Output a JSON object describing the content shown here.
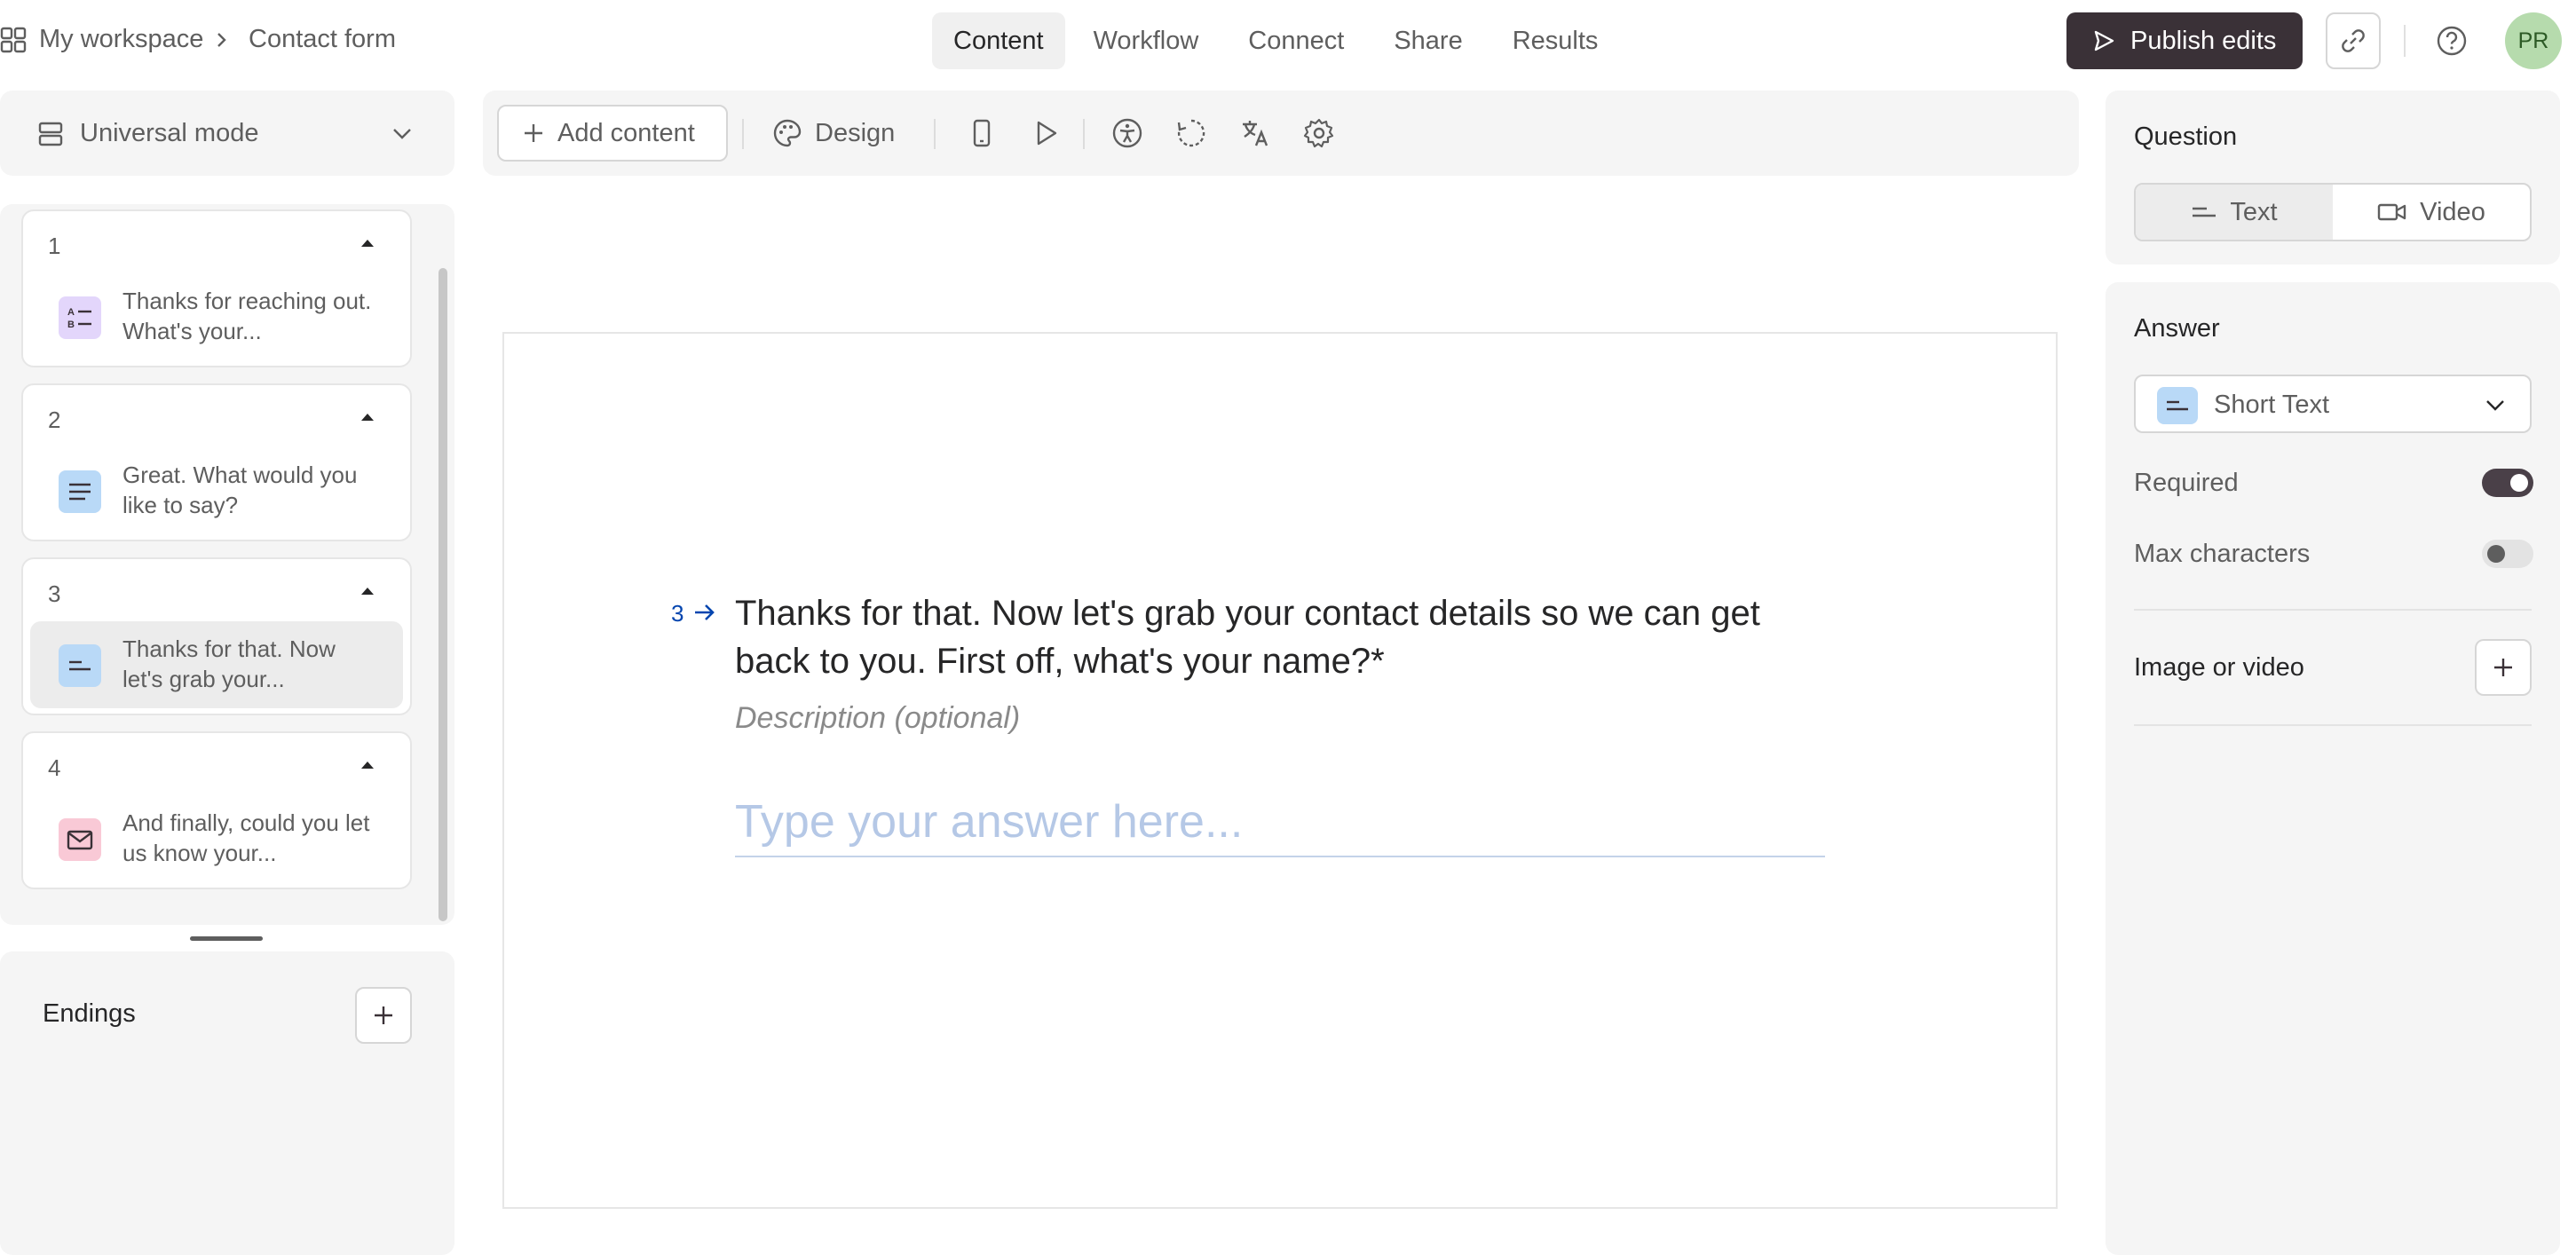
{
  "breadcrumb": {
    "workspace": "My workspace",
    "form": "Contact form"
  },
  "nav": {
    "tabs": [
      "Content",
      "Workflow",
      "Connect",
      "Share",
      "Results"
    ],
    "active": "Content"
  },
  "header": {
    "publish_label": "Publish edits",
    "avatar_initials": "PR"
  },
  "left_panel": {
    "mode_label": "Universal mode",
    "questions": [
      {
        "number": "1",
        "text": "Thanks for reaching out. What's your...",
        "icon": "multiple-choice-icon",
        "icon_bg": "#e3d6fb"
      },
      {
        "number": "2",
        "text": "Great. What would you like to say?",
        "icon": "long-text-icon",
        "icon_bg": "#b9d9f7"
      },
      {
        "number": "3",
        "text": "Thanks for that. Now let's grab your...",
        "icon": "short-text-icon",
        "icon_bg": "#b9d9f7",
        "selected": true
      },
      {
        "number": "4",
        "text": "And finally, could you let us know your...",
        "icon": "email-icon",
        "icon_bg": "#f9c9d6"
      }
    ],
    "endings_label": "Endings"
  },
  "toolbar": {
    "add_content_label": "Add content",
    "design_label": "Design"
  },
  "canvas": {
    "question_number": "3",
    "question_title": "Thanks for that. Now let's grab your contact details so we can get back to you. First off, what's your name?*",
    "description_placeholder": "Description (optional)",
    "answer_placeholder": "Type your answer here..."
  },
  "right_panel": {
    "question_heading": "Question",
    "question_types": [
      "Text",
      "Video"
    ],
    "question_type_active": "Text",
    "answer_heading": "Answer",
    "answer_type": "Short Text",
    "required_label": "Required",
    "required_on": true,
    "max_chars_label": "Max characters",
    "max_chars_on": false,
    "media_label": "Image or video"
  },
  "colors": {
    "accent_dark": "#3a3137",
    "avatar_bg": "#b6dbad",
    "question_number": "#0445af"
  }
}
